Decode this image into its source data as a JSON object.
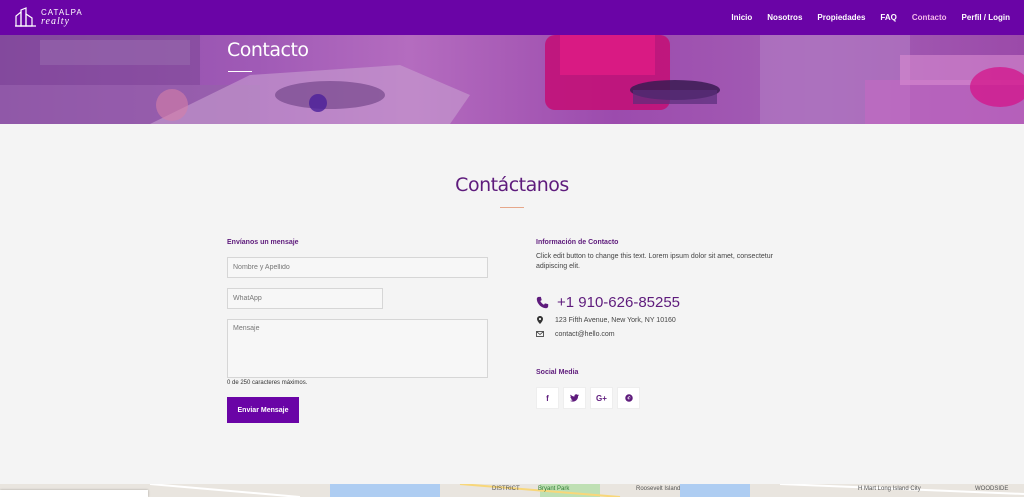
{
  "brand": {
    "line1": "CATALPA",
    "line2": "realty"
  },
  "nav": {
    "items": [
      {
        "label": "Inicio"
      },
      {
        "label": "Nosotros"
      },
      {
        "label": "Propiedades"
      },
      {
        "label": "FAQ"
      },
      {
        "label": "Contacto",
        "active": true
      },
      {
        "label": "Perfil / Login"
      }
    ]
  },
  "hero": {
    "title": "Contacto"
  },
  "section": {
    "title": "Contáctanos"
  },
  "form": {
    "heading": "Envíanos un mensaje",
    "name_placeholder": "Nombre y Apellido",
    "whatsapp_placeholder": "WhatApp",
    "message_placeholder": "Mensaje",
    "char_note": "0 de 250 caracteres máximos.",
    "submit_label": "Enviar Mensaje"
  },
  "info": {
    "heading": "Información de Contacto",
    "text": "Click edit button to change this text. Lorem ipsum dolor sit amet, consectetur adipiscing elit.",
    "phone": "+1 910-626-85255",
    "address": "123 Fifth Avenue, New York, NY 10160",
    "email": "contact@hello.com"
  },
  "social": {
    "heading": "Social Media",
    "buttons": [
      {
        "icon": "facebook-icon",
        "glyph": "f"
      },
      {
        "icon": "twitter-icon",
        "glyph": "t"
      },
      {
        "icon": "google-plus-icon",
        "glyph": "G+"
      },
      {
        "icon": "pinterest-icon",
        "glyph": "p"
      }
    ]
  },
  "map": {
    "labels": [
      "DISTRICT",
      "Bryant Park",
      "Roosevelt Island",
      "H Mart Long Island City",
      "WOODSIDE"
    ]
  },
  "colors": {
    "brand": "#6a04a6",
    "heading": "#5e1b7c",
    "accent_line": "#e6a78a",
    "active_nav": "#f3b8e9"
  }
}
